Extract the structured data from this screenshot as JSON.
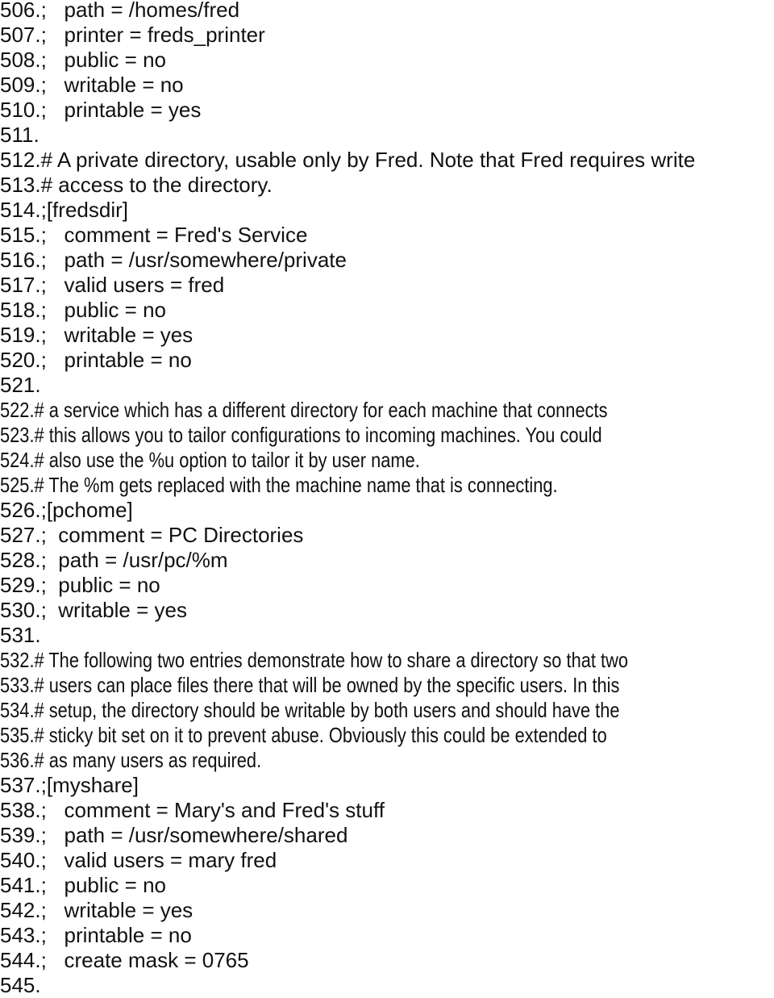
{
  "document": {
    "lines": [
      {
        "n": "506.",
        "t": ";   path = /homes/fred",
        "k": "set"
      },
      {
        "n": "507.",
        "t": ";   printer = freds_printer",
        "k": "set"
      },
      {
        "n": "508.",
        "t": ";   public = no",
        "k": "set"
      },
      {
        "n": "509.",
        "t": ";   writable = no",
        "k": "set"
      },
      {
        "n": "510.",
        "t": ";   printable = yes",
        "k": "set"
      },
      {
        "n": "511.",
        "t": "",
        "k": "blank"
      },
      {
        "n": "512.",
        "t": "# A private directory, usable only by Fred. Note that Fred requires write",
        "k": "set"
      },
      {
        "n": "513.",
        "t": "# access to the directory.",
        "k": "set"
      },
      {
        "n": "514.",
        "t": ";[fredsdir]",
        "k": "set"
      },
      {
        "n": "515.",
        "t": ";   comment = Fred's Service",
        "k": "set"
      },
      {
        "n": "516.",
        "t": ";   path = /usr/somewhere/private",
        "k": "set"
      },
      {
        "n": "517.",
        "t": ";   valid users = fred",
        "k": "set"
      },
      {
        "n": "518.",
        "t": ";   public = no",
        "k": "set"
      },
      {
        "n": "519.",
        "t": ";   writable = yes",
        "k": "set"
      },
      {
        "n": "520.",
        "t": ";   printable = no",
        "k": "set"
      },
      {
        "n": "521.",
        "t": "",
        "k": "blank"
      },
      {
        "n": "522.",
        "t": "# a service which has a different directory for each machine that connects",
        "k": "cmt"
      },
      {
        "n": "523.",
        "t": "# this allows you to tailor configurations to incoming machines. You could",
        "k": "cmt"
      },
      {
        "n": "524.",
        "t": "# also use the %u option to tailor it by user name.",
        "k": "cmt"
      },
      {
        "n": "525.",
        "t": "# The %m gets replaced with the machine name that is connecting.",
        "k": "cmt"
      },
      {
        "n": "526.",
        "t": ";[pchome]",
        "k": "set"
      },
      {
        "n": "527.",
        "t": ";  comment = PC Directories",
        "k": "set"
      },
      {
        "n": "528.",
        "t": ";  path = /usr/pc/%m",
        "k": "set"
      },
      {
        "n": "529.",
        "t": ";  public = no",
        "k": "set"
      },
      {
        "n": "530.",
        "t": ";  writable = yes",
        "k": "set"
      },
      {
        "n": "531.",
        "t": "",
        "k": "blank"
      },
      {
        "n": "532.",
        "t": "# The following two entries demonstrate how to share a directory so that two",
        "k": "cmt"
      },
      {
        "n": "533.",
        "t": "# users can place files there that will be owned by the specific users. In this",
        "k": "cmt"
      },
      {
        "n": "534.",
        "t": "# setup, the directory should be writable by both users and should have the",
        "k": "cmt"
      },
      {
        "n": "535.",
        "t": "# sticky bit set on it to prevent abuse. Obviously this could be extended to",
        "k": "cmt"
      },
      {
        "n": "536.",
        "t": "# as many users as required.",
        "k": "cmt"
      },
      {
        "n": "537.",
        "t": ";[myshare]",
        "k": "set"
      },
      {
        "n": "538.",
        "t": ";   comment = Mary's and Fred's stuff",
        "k": "set"
      },
      {
        "n": "539.",
        "t": ";   path = /usr/somewhere/shared",
        "k": "set"
      },
      {
        "n": "540.",
        "t": ";   valid users = mary fred",
        "k": "set"
      },
      {
        "n": "541.",
        "t": ";   public = no",
        "k": "set"
      },
      {
        "n": "542.",
        "t": ";   writable = yes",
        "k": "set"
      },
      {
        "n": "543.",
        "t": ";   printable = no",
        "k": "set"
      },
      {
        "n": "544.",
        "t": ";   create mask = 0765",
        "k": "set"
      },
      {
        "n": "545.",
        "t": "",
        "k": "blank"
      }
    ]
  }
}
